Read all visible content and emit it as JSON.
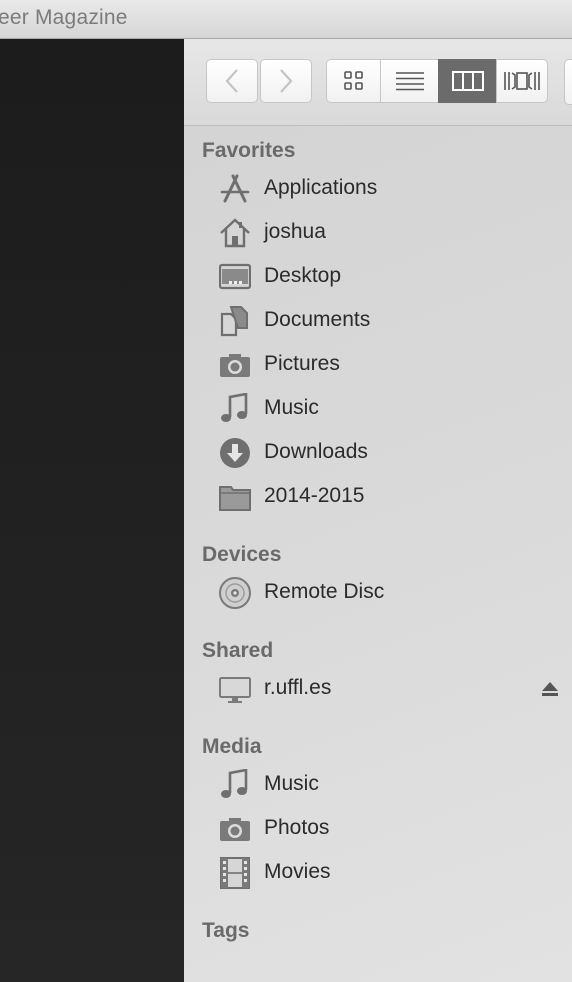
{
  "window": {
    "title_fragment": "eer Magazine"
  },
  "toolbar": {
    "back_label": "<",
    "forward_label": ">",
    "view_modes": [
      "icon-view",
      "list-view",
      "column-view",
      "cover-flow-view"
    ],
    "active_view": "column-view"
  },
  "sidebar": {
    "favorites": {
      "header": "Favorites",
      "items": [
        {
          "label": "Applications",
          "icon": "applications-icon"
        },
        {
          "label": "joshua",
          "icon": "home-icon"
        },
        {
          "label": "Desktop",
          "icon": "desktop-icon"
        },
        {
          "label": "Documents",
          "icon": "documents-icon"
        },
        {
          "label": "Pictures",
          "icon": "camera-icon"
        },
        {
          "label": "Music",
          "icon": "music-note-icon"
        },
        {
          "label": "Downloads",
          "icon": "download-icon"
        },
        {
          "label": "2014-2015",
          "icon": "folder-icon"
        }
      ]
    },
    "devices": {
      "header": "Devices",
      "items": [
        {
          "label": "Remote Disc",
          "icon": "disc-icon"
        }
      ]
    },
    "shared": {
      "header": "Shared",
      "items": [
        {
          "label": "r.uffl.es",
          "icon": "monitor-icon",
          "eject": "eject-icon"
        }
      ]
    },
    "media": {
      "header": "Media",
      "items": [
        {
          "label": "Music",
          "icon": "music-note-icon"
        },
        {
          "label": "Photos",
          "icon": "camera-icon"
        },
        {
          "label": "Movies",
          "icon": "film-icon"
        }
      ]
    },
    "tags": {
      "header": "Tags"
    }
  },
  "colors": {
    "sidebar_bg": "#dadada",
    "icon_gray": "#6f6f6f",
    "header_gray": "#6a6a6a",
    "active_view_bg": "#6b6b6b"
  }
}
